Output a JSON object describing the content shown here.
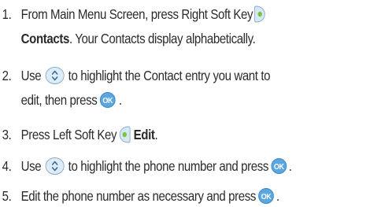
{
  "steps": [
    {
      "number": "1.",
      "line1": {
        "text_a": "From Main Menu Screen, press Right Soft Key"
      },
      "line2": {
        "bold": "Contacts",
        "text_a": ". Your Contacts display alphabetically."
      }
    },
    {
      "number": "2.",
      "line1": {
        "text_a": "Use",
        "text_b": "to highlight the Contact entry you want to"
      },
      "line2": {
        "text_a": "edit, then press",
        "text_b": "."
      }
    },
    {
      "number": "3.",
      "line1": {
        "text_a": "Press Left Soft Key",
        "bold": "Edit",
        "text_b": "."
      }
    },
    {
      "number": "4.",
      "line1": {
        "text_a": "Use",
        "text_b": "to highlight the phone number and press",
        "text_c": "."
      }
    },
    {
      "number": "5.",
      "line1": {
        "text_a": "Edit the phone number as necessary and press",
        "text_b": "."
      }
    }
  ],
  "icons": {
    "ok_label": "OK",
    "ok_color": "#5aa6e0",
    "softkey_color": "#d6e8f6",
    "softkey_dot_color": "#7dc243",
    "nav_color": "#dcecf8"
  }
}
